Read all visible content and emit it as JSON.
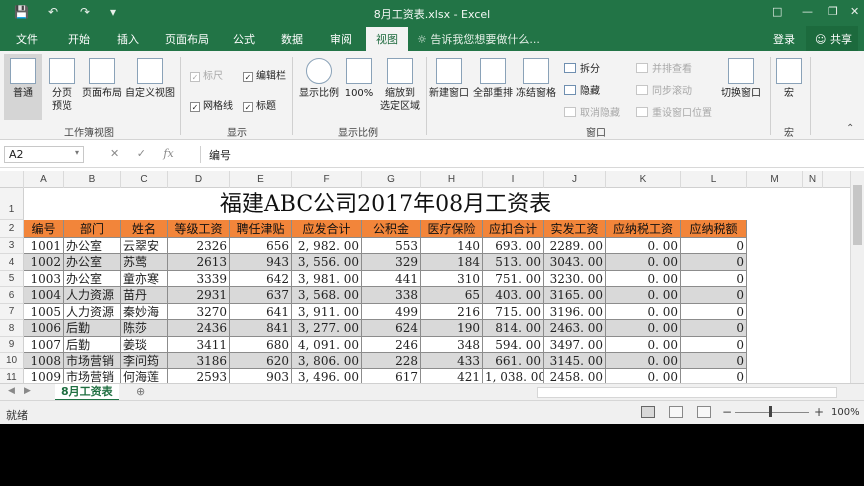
{
  "titlebar": {
    "save_icon": "save-icon",
    "undo_icon": "undo-icon",
    "redo_icon": "redo-icon",
    "customize_icon": "customize-icon",
    "title": "8月工资表.xlsx - Excel"
  },
  "tabs": [
    "文件",
    "开始",
    "插入",
    "页面布局",
    "公式",
    "数据",
    "审阅",
    "视图"
  ],
  "tell_me": "告诉我您想要做什么...",
  "login": "登录",
  "share": "共享",
  "ribbon": {
    "workbook_views": {
      "label": "工作簿视图",
      "normal": "普通",
      "page_break_l1": "分页",
      "page_break_l2": "预览",
      "page_layout": "页面布局",
      "custom_views": "自定义视图"
    },
    "show": {
      "label": "显示",
      "ruler": "标尺",
      "formula_bar": "编辑栏",
      "gridlines": "网格线",
      "headings": "标题"
    },
    "zoom": {
      "label": "显示比例",
      "zoom": "显示比例",
      "hundred": "100%",
      "sel_l1": "缩放到",
      "sel_l2": "选定区域"
    },
    "window": {
      "label": "窗口",
      "new_window": "新建窗口",
      "arrange_all": "全部重排",
      "freeze": "冻结窗格",
      "split": "拆分",
      "hide": "隐藏",
      "unhide": "取消隐藏",
      "side_by_side": "并排查看",
      "sync_scroll": "同步滚动",
      "reset_pos": "重设窗口位置",
      "switch": "切换窗口"
    },
    "macros": {
      "label": "宏",
      "macro": "宏"
    }
  },
  "formula_bar": {
    "name_box": "A2",
    "formula": "编号"
  },
  "columns": [
    "A",
    "B",
    "C",
    "D",
    "E",
    "F",
    "G",
    "H",
    "I",
    "J",
    "K",
    "L",
    "M",
    "N"
  ],
  "rows": [
    "1",
    "2",
    "3",
    "4",
    "5",
    "6",
    "7",
    "8",
    "9",
    "10",
    "11"
  ],
  "sheet": {
    "title": "福建ABC公司2017年08月工资表",
    "headers": [
      "编号",
      "部门",
      "姓名",
      "等级工资",
      "聘任津贴",
      "应发合计",
      "公积金",
      "医疗保险",
      "应扣合计",
      "实发工资",
      "应纳税工资",
      "应纳税额"
    ],
    "data": [
      [
        "1001",
        "办公室",
        "云翠安",
        "2326",
        "656",
        "2, 982. 00",
        "553",
        "140",
        "693. 00",
        "2289. 00",
        "0. 00",
        "0"
      ],
      [
        "1002",
        "办公室",
        "苏莺",
        "2613",
        "943",
        "3, 556. 00",
        "329",
        "184",
        "513. 00",
        "3043. 00",
        "0. 00",
        "0"
      ],
      [
        "1003",
        "办公室",
        "童亦寒",
        "3339",
        "642",
        "3, 981. 00",
        "441",
        "310",
        "751. 00",
        "3230. 00",
        "0. 00",
        "0"
      ],
      [
        "1004",
        "人力资源",
        "苗丹",
        "2931",
        "637",
        "3, 568. 00",
        "338",
        "65",
        "403. 00",
        "3165. 00",
        "0. 00",
        "0"
      ],
      [
        "1005",
        "人力资源",
        "秦妙海",
        "3270",
        "641",
        "3, 911. 00",
        "499",
        "216",
        "715. 00",
        "3196. 00",
        "0. 00",
        "0"
      ],
      [
        "1006",
        "后勤",
        "陈莎",
        "2436",
        "841",
        "3, 277. 00",
        "624",
        "190",
        "814. 00",
        "2463. 00",
        "0. 00",
        "0"
      ],
      [
        "1007",
        "后勤",
        "姜琰",
        "3411",
        "680",
        "4, 091. 00",
        "246",
        "348",
        "594. 00",
        "3497. 00",
        "0. 00",
        "0"
      ],
      [
        "1008",
        "市场营销",
        "李问筠",
        "3186",
        "620",
        "3, 806. 00",
        "228",
        "433",
        "661. 00",
        "3145. 00",
        "0. 00",
        "0"
      ],
      [
        "1009",
        "市场营销",
        "何海莲",
        "2593",
        "903",
        "3, 496. 00",
        "617",
        "421",
        "1, 038. 00",
        "2458. 00",
        "0. 00",
        "0"
      ]
    ]
  },
  "sheet_tab": "8月工资表",
  "status": {
    "ready": "就绪",
    "zoom": "100%"
  }
}
